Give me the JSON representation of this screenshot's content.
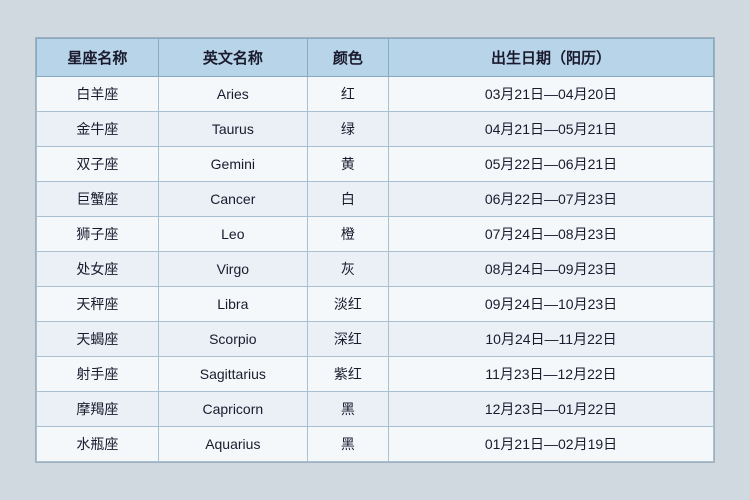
{
  "table": {
    "headers": {
      "col1": "星座名称",
      "col2": "英文名称",
      "col3": "颜色",
      "col4": "出生日期（阳历）"
    },
    "rows": [
      {
        "chinese": "白羊座",
        "english": "Aries",
        "color": "红",
        "date": "03月21日—04月20日"
      },
      {
        "chinese": "金牛座",
        "english": "Taurus",
        "color": "绿",
        "date": "04月21日—05月21日"
      },
      {
        "chinese": "双子座",
        "english": "Gemini",
        "color": "黄",
        "date": "05月22日—06月21日"
      },
      {
        "chinese": "巨蟹座",
        "english": "Cancer",
        "color": "白",
        "date": "06月22日—07月23日"
      },
      {
        "chinese": "狮子座",
        "english": "Leo",
        "color": "橙",
        "date": "07月24日—08月23日"
      },
      {
        "chinese": "处女座",
        "english": "Virgo",
        "color": "灰",
        "date": "08月24日—09月23日"
      },
      {
        "chinese": "天秤座",
        "english": "Libra",
        "color": "淡红",
        "date": "09月24日—10月23日"
      },
      {
        "chinese": "天蝎座",
        "english": "Scorpio",
        "color": "深红",
        "date": "10月24日—11月22日"
      },
      {
        "chinese": "射手座",
        "english": "Sagittarius",
        "color": "紫红",
        "date": "11月23日—12月22日"
      },
      {
        "chinese": "摩羯座",
        "english": "Capricorn",
        "color": "黑",
        "date": "12月23日—01月22日"
      },
      {
        "chinese": "水瓶座",
        "english": "Aquarius",
        "color": "黑",
        "date": "01月21日—02月19日"
      }
    ]
  }
}
